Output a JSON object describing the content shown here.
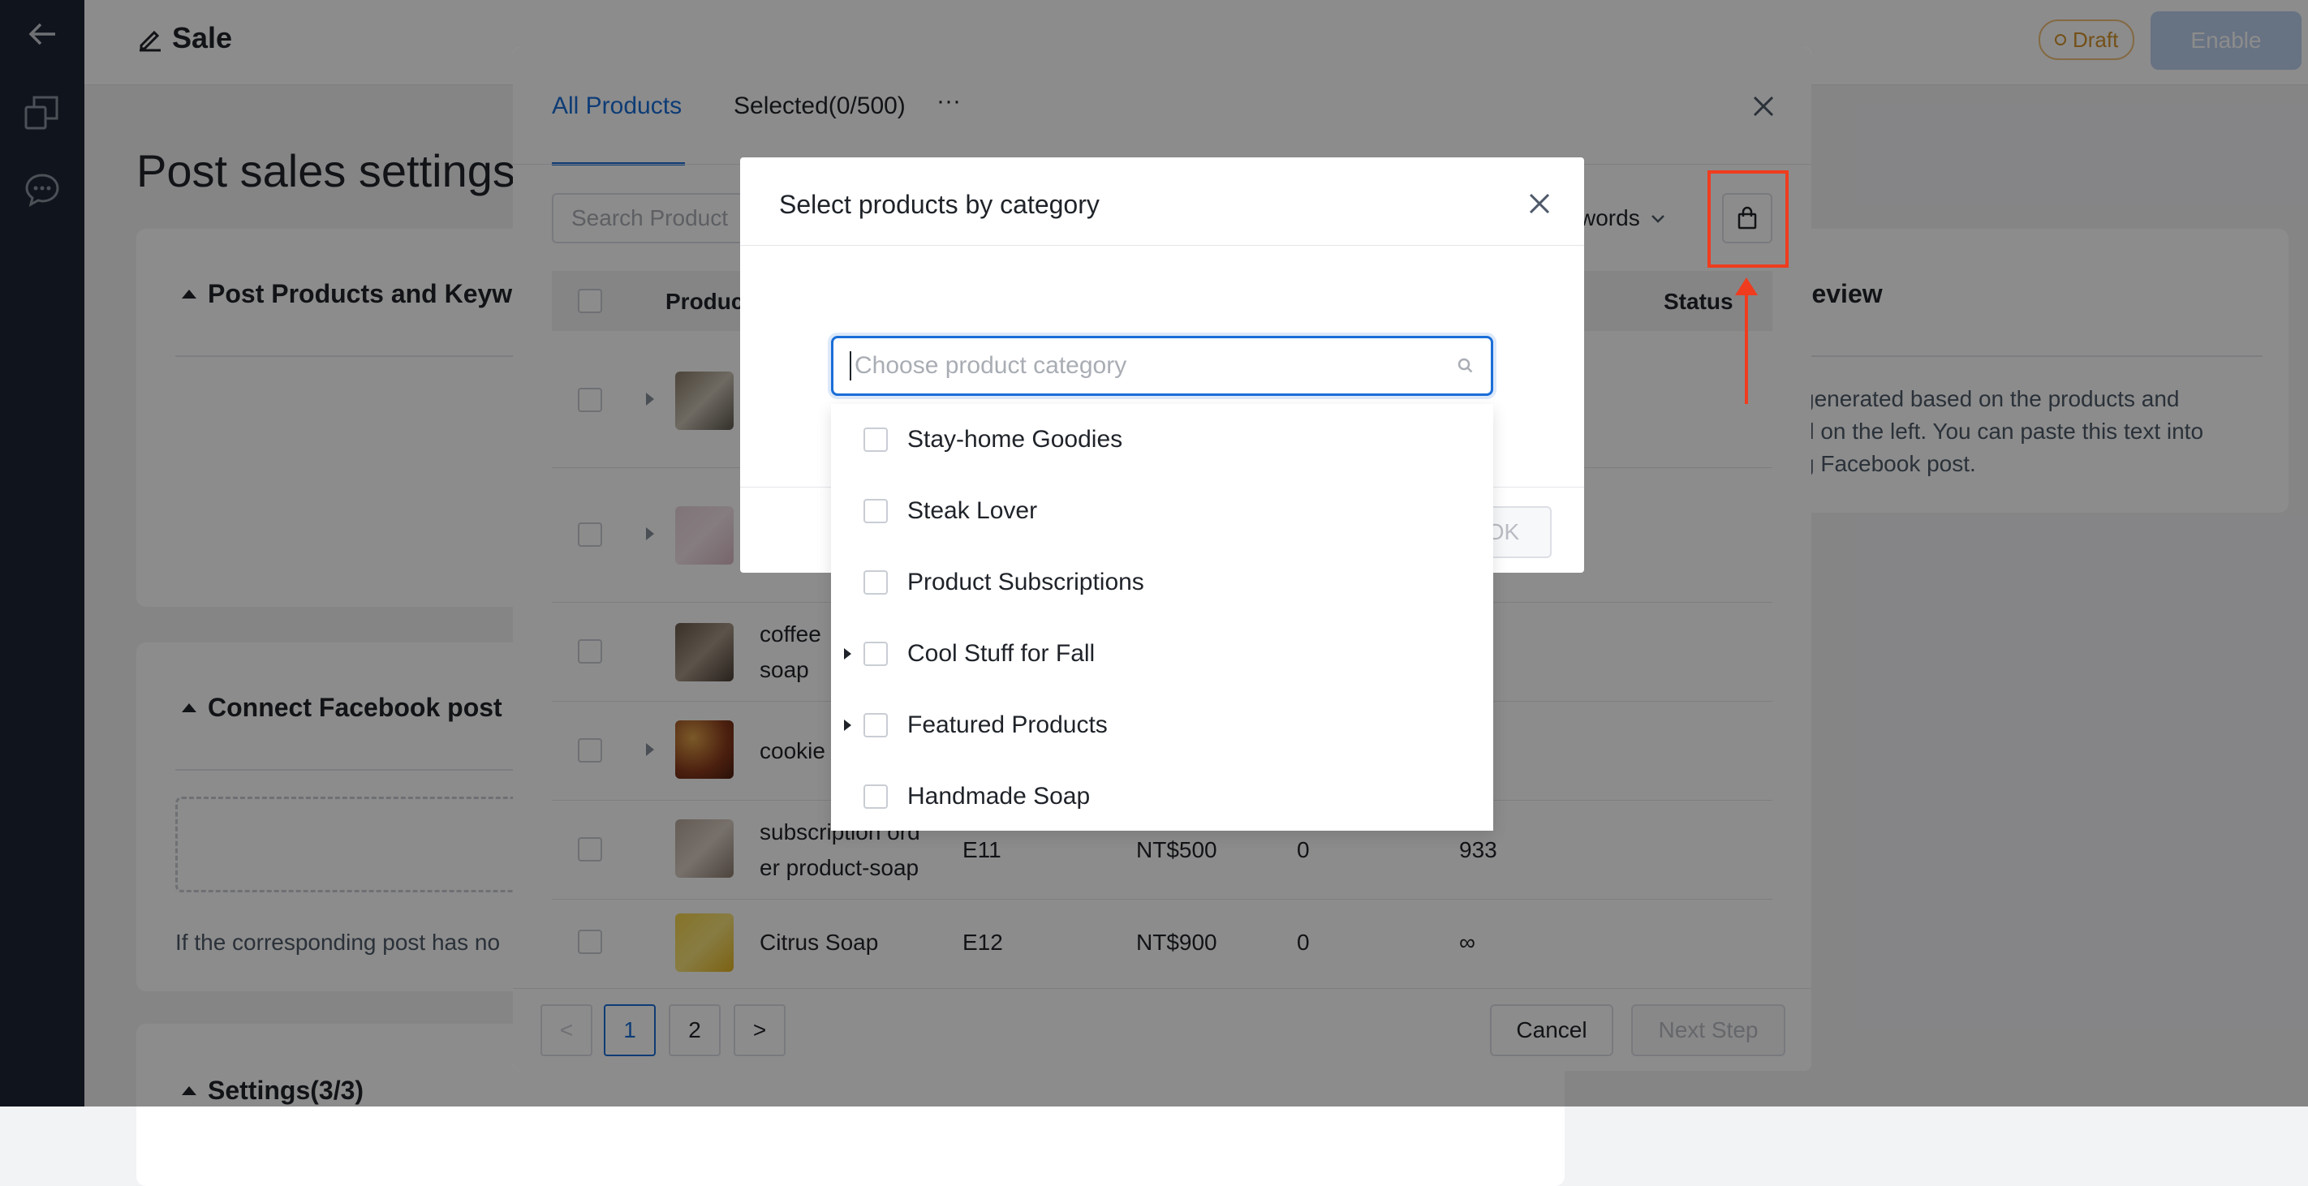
{
  "page": {
    "title": "Sale",
    "status_badge": "Draft",
    "enable_label": "Enable",
    "heading": "Post sales settings",
    "cards": {
      "products_keywords": "Post Products and Keywo",
      "connect_post": "Connect Facebook post",
      "connect_hint": "If the corresponding post has no",
      "settings": "Settings(3/3)",
      "preview_title": "review",
      "preview_text_1": "generated based on the products and",
      "preview_text_2": "d on the left. You can paste this text into",
      "preview_text_3": "g Facebook post."
    }
  },
  "modal": {
    "tabs": [
      {
        "label": "All Products",
        "active": true
      },
      {
        "label": "Selected(0/500)",
        "active": false
      }
    ],
    "more_label": "···",
    "search_placeholder": "Search Product",
    "keyword_select": "ywords",
    "table": {
      "headers": {
        "product": "Produc",
        "status": "Status"
      },
      "rows": [
        {
          "name": "",
          "code": "",
          "price": "",
          "qty": "",
          "stock": "",
          "expandable": true
        },
        {
          "name": "",
          "code": "",
          "price": "",
          "qty": "",
          "stock": "",
          "expandable": true
        },
        {
          "name": "coffee soap",
          "name_l1": "coffee",
          "name_l2": "soap",
          "code": "",
          "price": "",
          "qty": "",
          "stock": "",
          "expandable": false
        },
        {
          "name": "cookie",
          "code": "",
          "price": "",
          "qty": "",
          "stock": "",
          "expandable": true
        },
        {
          "name_l1": "subscription ord",
          "name_l2": "er product-soap",
          "code": "E11",
          "price": "NT$500",
          "qty": "0",
          "stock": "933",
          "expandable": false
        },
        {
          "name": "Citrus Soap",
          "code": "E12",
          "price": "NT$900",
          "qty": "0",
          "stock": "∞",
          "expandable": false
        }
      ]
    },
    "pagination": {
      "prev": "<",
      "pages": [
        "1",
        "2"
      ],
      "next": ">",
      "current": "1"
    },
    "cancel_label": "Cancel",
    "next_label": "Next Step"
  },
  "dialog": {
    "title": "Select products by category",
    "ok_label": "OK",
    "input_placeholder": "Choose product category",
    "categories": [
      {
        "label": "Stay-home Goodies",
        "has_children": false
      },
      {
        "label": "Steak Lover",
        "has_children": false
      },
      {
        "label": "Product Subscriptions",
        "has_children": false
      },
      {
        "label": "Cool Stuff for Fall",
        "has_children": true
      },
      {
        "label": "Featured Products",
        "has_children": true
      },
      {
        "label": "Handmade Soap",
        "has_children": false
      }
    ]
  },
  "colors": {
    "accent": "#1a6ed8",
    "annotation": "#f03c1e",
    "rail": "#1e2633"
  }
}
